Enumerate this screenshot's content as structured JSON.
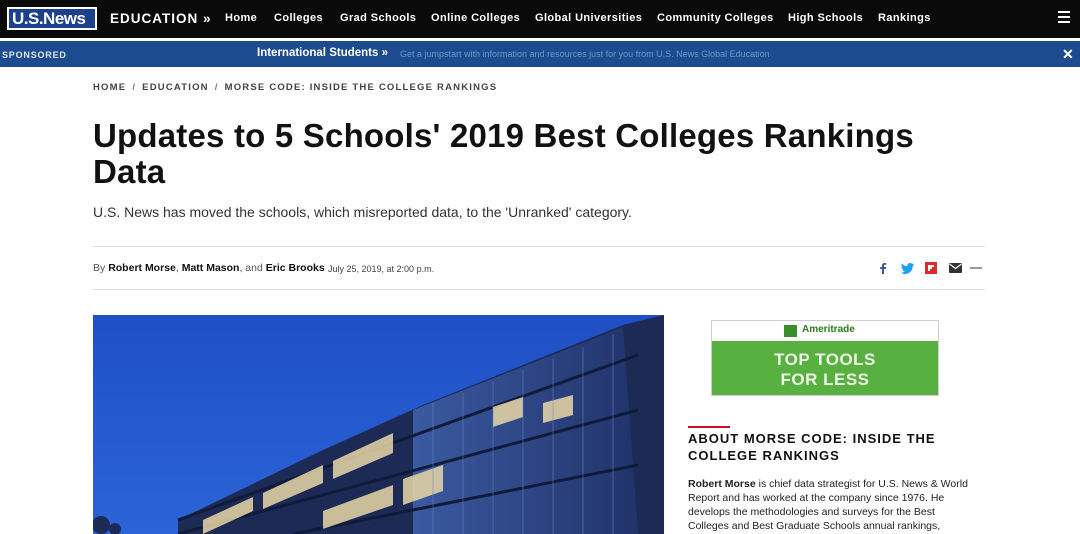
{
  "header": {
    "logo_text": "U.S.News",
    "section": "EDUCATION »",
    "nav": [
      {
        "label": "Home"
      },
      {
        "label": "Colleges"
      },
      {
        "label": "Grad Schools"
      },
      {
        "label": "Online Colleges"
      },
      {
        "label": "Global Universities"
      },
      {
        "label": "Community Colleges"
      },
      {
        "label": "High Schools"
      },
      {
        "label": "Rankings"
      }
    ],
    "menu_icon": "hamburger-menu-icon"
  },
  "sponsor_bar": {
    "label": "SPONSORED",
    "title": "International Students »",
    "text": "Get a jumpstart with information and resources just for you from U.S. News Global Education",
    "close_icon": "close-icon"
  },
  "breadcrumb": [
    "HOME",
    "EDUCATION",
    "MORSE CODE: INSIDE THE COLLEGE RANKINGS"
  ],
  "article": {
    "title": "Updates to 5 Schools' 2019 Best Colleges Rankings Data",
    "dek": "U.S. News has moved the schools, which misreported data, to the 'Unranked' category.",
    "byline_prefix": "By",
    "authors": [
      "Robert Morse",
      "Matt Mason",
      "Eric Brooks"
    ],
    "date": "July 25, 2019, at 2:00 p.m."
  },
  "share": {
    "icons": [
      "facebook-icon",
      "twitter-icon",
      "flipboard-icon",
      "email-icon",
      "more-icon"
    ],
    "colors": {
      "facebook": "#3b5998",
      "twitter": "#1da1f2",
      "flipboard": "#e12828",
      "email": "#333333"
    }
  },
  "ad": {
    "brand": "Ameritrade",
    "line1": "TOP TOOLS",
    "line2": "FOR LESS",
    "color": "#58b041"
  },
  "sidebar": {
    "heading": "ABOUT MORSE CODE: INSIDE THE COLLEGE RANKINGS",
    "author_name": "Robert Morse",
    "body": " is chief data strategist for U.S. News & World Report and has worked at the company since 1976. He develops the methodologies and surveys for the Best Colleges and Best Graduate Schools annual rankings,"
  }
}
